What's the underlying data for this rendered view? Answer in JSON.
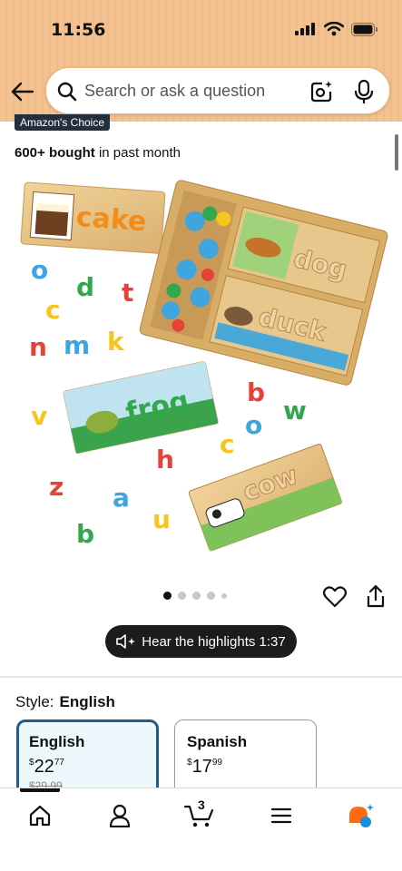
{
  "status": {
    "time": "11:56"
  },
  "search": {
    "placeholder": "Search or ask a question"
  },
  "product": {
    "badge": "Amazon's Choice",
    "bought_count": "600+ bought",
    "bought_suffix": "in past month",
    "image_words": [
      "cake",
      "dog",
      "duck",
      "frog",
      "cow"
    ],
    "image_letters": [
      "o",
      "d",
      "t",
      "c",
      "n",
      "m",
      "k",
      "v",
      "z",
      "a",
      "b",
      "u",
      "h",
      "c",
      "o",
      "w",
      "b"
    ],
    "carousel_dots": 5,
    "carousel_active": 0
  },
  "highlights": {
    "label": "Hear the highlights 1:37"
  },
  "style": {
    "label": "Style:",
    "selected": "English",
    "options": [
      {
        "name": "English",
        "price_symbol": "$",
        "price_whole": "22",
        "price_fraction": "77",
        "strike": "$29.99"
      },
      {
        "name": "Spanish",
        "price_symbol": "$",
        "price_whole": "17",
        "price_fraction": "99"
      }
    ]
  },
  "nav": {
    "cart_count": "3"
  },
  "colors": {
    "header": "#f3c290",
    "selected_border": "#1f5e8c",
    "selected_bg": "#edf8fd",
    "pill": "#1c1c1c"
  }
}
